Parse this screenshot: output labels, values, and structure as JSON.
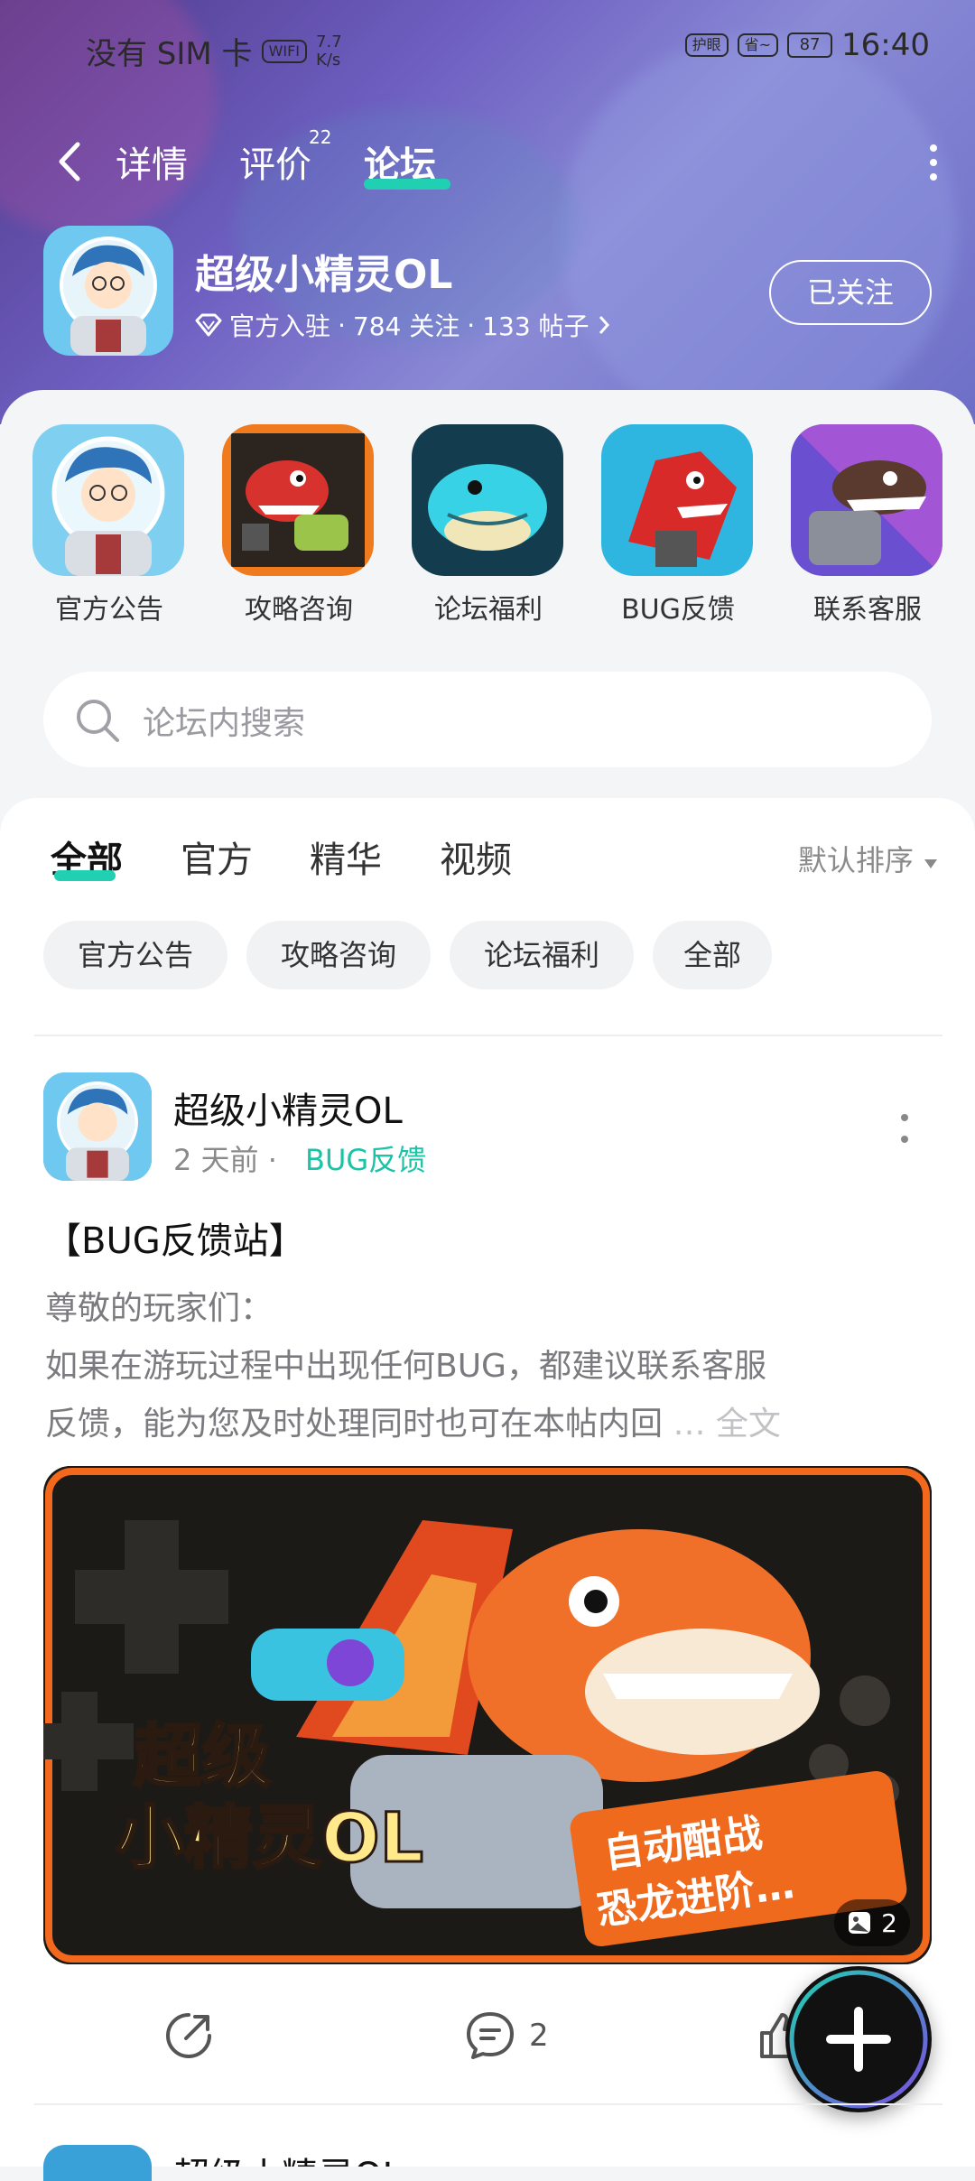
{
  "status_bar": {
    "carrier": "没有 SIM 卡",
    "wifi": "WIFI",
    "speed_value": "7.7",
    "speed_unit": "K/s",
    "badge1": "护眼",
    "badge2": "省~",
    "battery": "87",
    "time": "16:40"
  },
  "nav": {
    "tabs": [
      {
        "label": "详情"
      },
      {
        "label": "评价",
        "badge": "22"
      },
      {
        "label": "论坛"
      }
    ],
    "active_tab": "论坛"
  },
  "game": {
    "title": "超级小精灵OL",
    "verified_label": "官方入驻",
    "follows": "784 关注",
    "posts": "133 帖子",
    "follow_button": "已关注"
  },
  "categories": [
    {
      "label": "官方公告"
    },
    {
      "label": "攻略咨询"
    },
    {
      "label": "论坛福利"
    },
    {
      "label": "BUG反馈"
    },
    {
      "label": "联系客服"
    }
  ],
  "search": {
    "placeholder": "论坛内搜索"
  },
  "feed_tabs": [
    {
      "label": "全部"
    },
    {
      "label": "官方"
    },
    {
      "label": "精华"
    },
    {
      "label": "视频"
    }
  ],
  "sort_label": "默认排序",
  "chips": [
    {
      "label": "官方公告"
    },
    {
      "label": "攻略咨询"
    },
    {
      "label": "论坛福利"
    },
    {
      "label": "全部"
    }
  ],
  "post": {
    "author": "超级小精灵OL",
    "time": "2 天前",
    "tag": "BUG反馈",
    "title": "【BUG反馈站】",
    "body_lines": [
      "尊敬的玩家们：",
      " 如果在游玩过程中出现任何BUG，都建议联系客服",
      "反馈，能为您及时处理同时也可在本帖内回"
    ],
    "ellipsis": "…",
    "more_label": "全文",
    "banner_text_1": "超级",
    "banner_text_2": "小精灵OL",
    "banner_text_3": "自动酣战",
    "banner_text_4": "恐龙进阶…",
    "image_count": "2",
    "comments": "2"
  },
  "next_post": {
    "author": "超级小精灵OL"
  }
}
